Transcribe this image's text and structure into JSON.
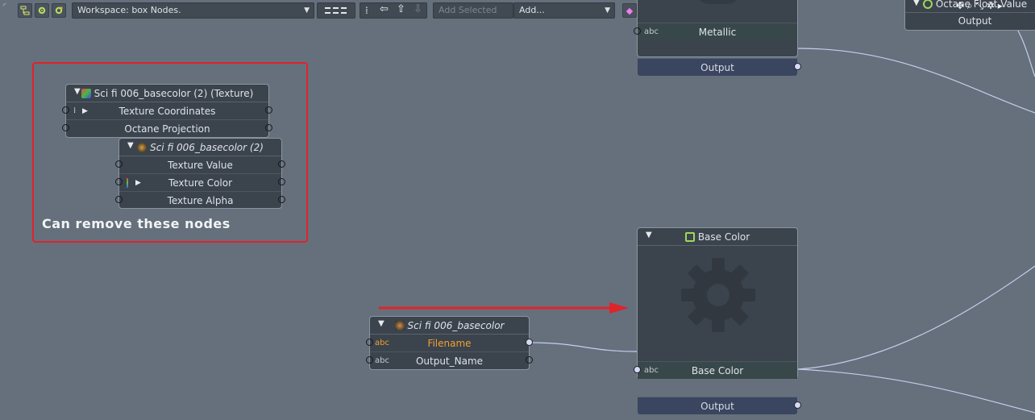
{
  "toolbar": {
    "workspace_value": "Workspace: box Nodes.",
    "add_selected_placeholder": "Add Selected",
    "add_value": "Add...",
    "layout_label": "☷"
  },
  "nodes": {
    "metallic_node": {
      "input_label": "Metallic",
      "input_type": "abc",
      "output_label": "Output"
    },
    "float_node": {
      "title": "Octane Float Value",
      "output_label": "Output"
    },
    "texture_node": {
      "title": "Sci fi 006_basecolor (2) (Texture)",
      "rows": [
        "Texture Coordinates",
        "Octane Projection"
      ]
    },
    "image_node_2": {
      "title": "Sci fi 006_basecolor (2)",
      "rows": [
        "Texture Value",
        "Texture Color",
        "Texture Alpha"
      ]
    },
    "image_node": {
      "title": "Sci fi 006_basecolor",
      "rows": [
        {
          "type": "abc",
          "label": "Filename"
        },
        {
          "type": "abc",
          "label": "Output_Name"
        }
      ]
    },
    "base_color_node": {
      "title": "Base Color",
      "input_label": "Base Color",
      "input_type": "abc",
      "output_label": "Output"
    }
  },
  "annotation": {
    "callout_text": "Can remove these nodes"
  },
  "colors": {
    "canvas": "#65707c",
    "node_body": "#3b434d",
    "callout_red": "#e0232a",
    "arrow_red": "#e0232a",
    "wire": "#c8ccec",
    "filename_orange": "#f0a030"
  }
}
